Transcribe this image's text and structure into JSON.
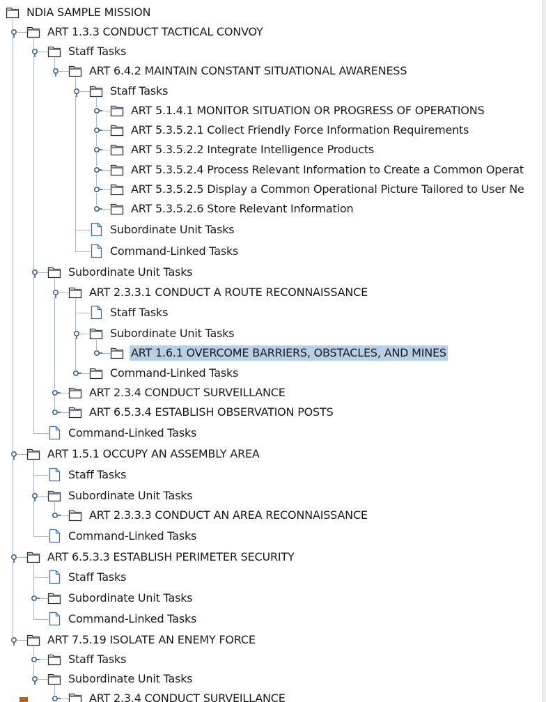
{
  "window": {
    "title": ""
  },
  "colors": {
    "selection": "#b8cfe5",
    "tree_line": "#a3b8cc"
  },
  "tree": {
    "rows": [
      {
        "label": "NDIA SAMPLE MISSION",
        "type": "folder",
        "handle": "none"
      },
      {
        "label": "ART 1.3.3 CONDUCT TACTICAL CONVOY",
        "type": "folder",
        "handle": "expanded"
      },
      {
        "label": "Staff Tasks",
        "type": "folder",
        "handle": "expanded"
      },
      {
        "label": "ART 6.4.2 MAINTAIN CONSTANT SITUATIONAL AWARENESS",
        "type": "folder",
        "handle": "expanded"
      },
      {
        "label": "Staff Tasks",
        "type": "folder",
        "handle": "expanded"
      },
      {
        "label": "ART 5.1.4.1 MONITOR SITUATION OR PROGRESS OF OPERATIONS",
        "type": "folder",
        "handle": "collapsed"
      },
      {
        "label": "ART 5.3.5.2.1 Collect Friendly Force Information Requirements",
        "type": "folder",
        "handle": "collapsed"
      },
      {
        "label": "ART 5.3.5.2.2 Integrate Intelligence Products",
        "type": "folder",
        "handle": "collapsed"
      },
      {
        "label": "ART 5.3.5.2.4 Process Relevant Information to Create a Common Operat",
        "type": "folder",
        "handle": "collapsed"
      },
      {
        "label": "ART 5.3.5.2.5 Display a Common Operational Picture Tailored to User Ne",
        "type": "folder",
        "handle": "collapsed"
      },
      {
        "label": "ART 5.3.5.2.6 Store Relevant Information",
        "type": "folder",
        "handle": "collapsed"
      },
      {
        "label": "Subordinate Unit Tasks",
        "type": "leaf",
        "handle": "none"
      },
      {
        "label": "Command-Linked Tasks",
        "type": "leaf",
        "handle": "none"
      },
      {
        "label": "Subordinate Unit Tasks",
        "type": "folder",
        "handle": "expanded"
      },
      {
        "label": "ART 2.3.3.1 CONDUCT A ROUTE RECONNAISSANCE",
        "type": "folder",
        "handle": "expanded"
      },
      {
        "label": "Staff Tasks",
        "type": "leaf",
        "handle": "none"
      },
      {
        "label": "Subordinate Unit Tasks",
        "type": "folder",
        "handle": "expanded"
      },
      {
        "label": "ART 1.6.1 OVERCOME BARRIERS, OBSTACLES, AND MINES",
        "type": "folder",
        "handle": "collapsed",
        "selected": "yes"
      },
      {
        "label": "Command-Linked Tasks",
        "type": "folder",
        "handle": "collapsed"
      },
      {
        "label": "ART 2.3.4 CONDUCT SURVEILLANCE",
        "type": "folder",
        "handle": "collapsed"
      },
      {
        "label": "ART 6.5.3.4 ESTABLISH OBSERVATION POSTS",
        "type": "folder",
        "handle": "collapsed"
      },
      {
        "label": "Command-Linked Tasks",
        "type": "leaf",
        "handle": "none"
      },
      {
        "label": "ART 1.5.1 OCCUPY AN ASSEMBLY AREA",
        "type": "folder",
        "handle": "expanded"
      },
      {
        "label": "Staff Tasks",
        "type": "leaf",
        "handle": "none"
      },
      {
        "label": "Subordinate Unit Tasks",
        "type": "folder",
        "handle": "expanded"
      },
      {
        "label": "ART 2.3.3.3 CONDUCT AN AREA RECONNAISSANCE",
        "type": "folder",
        "handle": "collapsed"
      },
      {
        "label": "Command-Linked Tasks",
        "type": "leaf",
        "handle": "none"
      },
      {
        "label": "ART 6.5.3.3 ESTABLISH PERIMETER SECURITY",
        "type": "folder",
        "handle": "expanded"
      },
      {
        "label": "Staff Tasks",
        "type": "leaf",
        "handle": "none"
      },
      {
        "label": "Subordinate Unit Tasks",
        "type": "folder",
        "handle": "collapsed"
      },
      {
        "label": "Command-Linked Tasks",
        "type": "leaf",
        "handle": "none"
      },
      {
        "label": "ART 7.5.19 ISOLATE AN ENEMY FORCE",
        "type": "folder",
        "handle": "expanded"
      },
      {
        "label": "Staff Tasks",
        "type": "folder",
        "handle": "collapsed"
      },
      {
        "label": "Subordinate Unit Tasks",
        "type": "folder",
        "handle": "expanded"
      },
      {
        "label": "ART 2.3.4 CONDUCT SURVEILLANCE",
        "type": "folder",
        "handle": "collapsed"
      }
    ]
  }
}
